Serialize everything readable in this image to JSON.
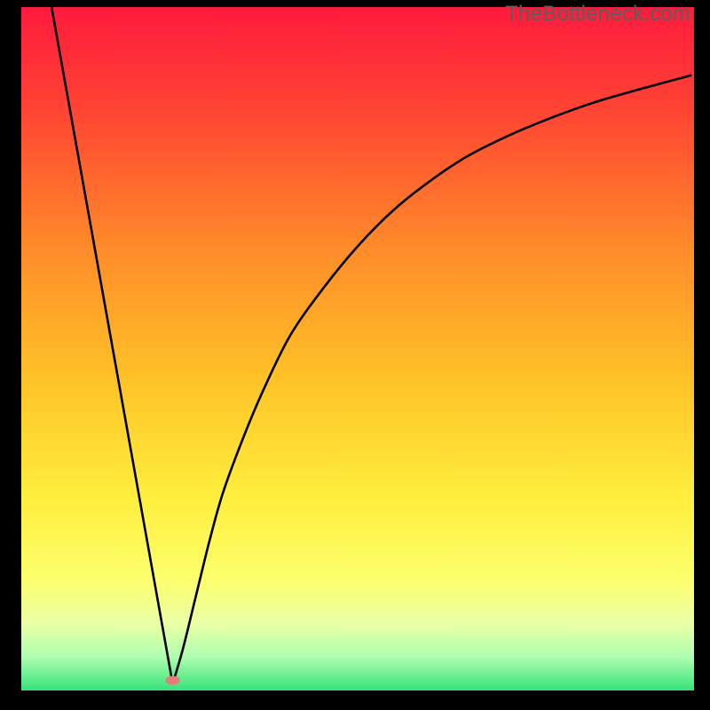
{
  "watermark": "TheBottleneck.com",
  "chart_data": {
    "type": "line",
    "title": "",
    "xlabel": "",
    "ylabel": "",
    "xlim": [
      0,
      100
    ],
    "ylim": [
      0,
      100
    ],
    "grid": false,
    "legend": false,
    "gradient_stops": [
      {
        "offset": 0.0,
        "color": "#ff1a3d"
      },
      {
        "offset": 0.15,
        "color": "#ff4433"
      },
      {
        "offset": 0.35,
        "color": "#ff8a2a"
      },
      {
        "offset": 0.55,
        "color": "#ffc427"
      },
      {
        "offset": 0.72,
        "color": "#ffef3e"
      },
      {
        "offset": 0.84,
        "color": "#fcff6e"
      },
      {
        "offset": 0.9,
        "color": "#ecffa6"
      },
      {
        "offset": 0.95,
        "color": "#b0ffb0"
      },
      {
        "offset": 1.0,
        "color": "#36e27a"
      }
    ],
    "series": [
      {
        "name": "left-line",
        "x": [
          4.5,
          22.5
        ],
        "y": [
          100,
          1
        ]
      },
      {
        "name": "right-curve",
        "x": [
          22.5,
          24,
          26,
          28,
          30,
          33,
          36,
          40,
          45,
          50,
          55,
          60,
          66,
          72,
          78,
          85,
          92,
          99.5
        ],
        "y": [
          1,
          6,
          14,
          22,
          29,
          37,
          44,
          52,
          59,
          65,
          70,
          74,
          78,
          81,
          83.5,
          86,
          88,
          90
        ]
      }
    ],
    "marker": {
      "x": 22.5,
      "y": 1.5,
      "color": "#e97a7a",
      "rx": 8,
      "ry": 5
    }
  }
}
